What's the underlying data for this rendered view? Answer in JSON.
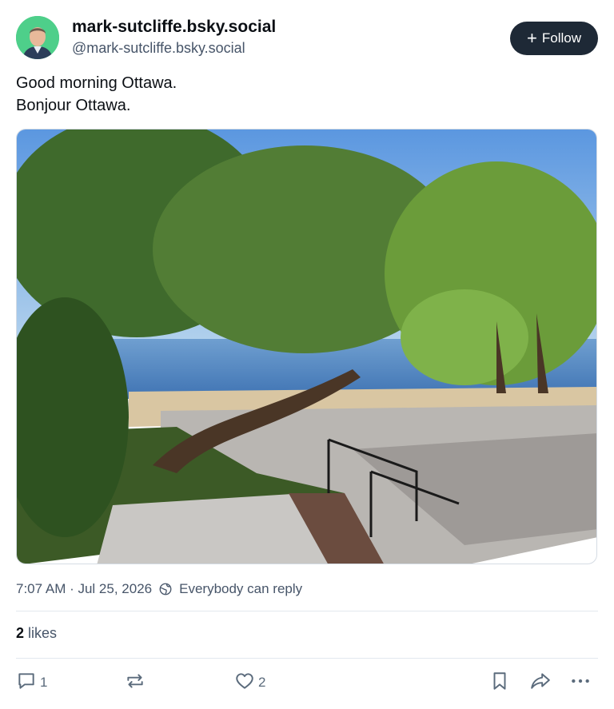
{
  "author": {
    "display_name": "mark-sutcliffe.bsky.social",
    "handle": "@mark-sutcliffe.bsky.social",
    "avatar_bg": "#4ecf8a"
  },
  "follow_button": {
    "icon": "plus-icon",
    "label": "Follow",
    "bg": "#1e2936"
  },
  "post": {
    "lines": [
      "Good morning Ottawa.",
      "Bonjour Ottawa."
    ]
  },
  "meta": {
    "timestamp": "7:07 AM · Jul 25, 2026",
    "reply_setting_icon": "globe-icon",
    "reply_setting": "Everybody can reply"
  },
  "likes": {
    "count": "2",
    "label": "likes"
  },
  "actions": {
    "reply": {
      "icon": "comment-icon",
      "count": "1"
    },
    "repost": {
      "icon": "repost-icon",
      "count": ""
    },
    "like": {
      "icon": "heart-icon",
      "count": "2"
    },
    "bookmark": {
      "icon": "bookmark-icon"
    },
    "share": {
      "icon": "share-icon"
    },
    "more": {
      "icon": "more-icon"
    }
  }
}
